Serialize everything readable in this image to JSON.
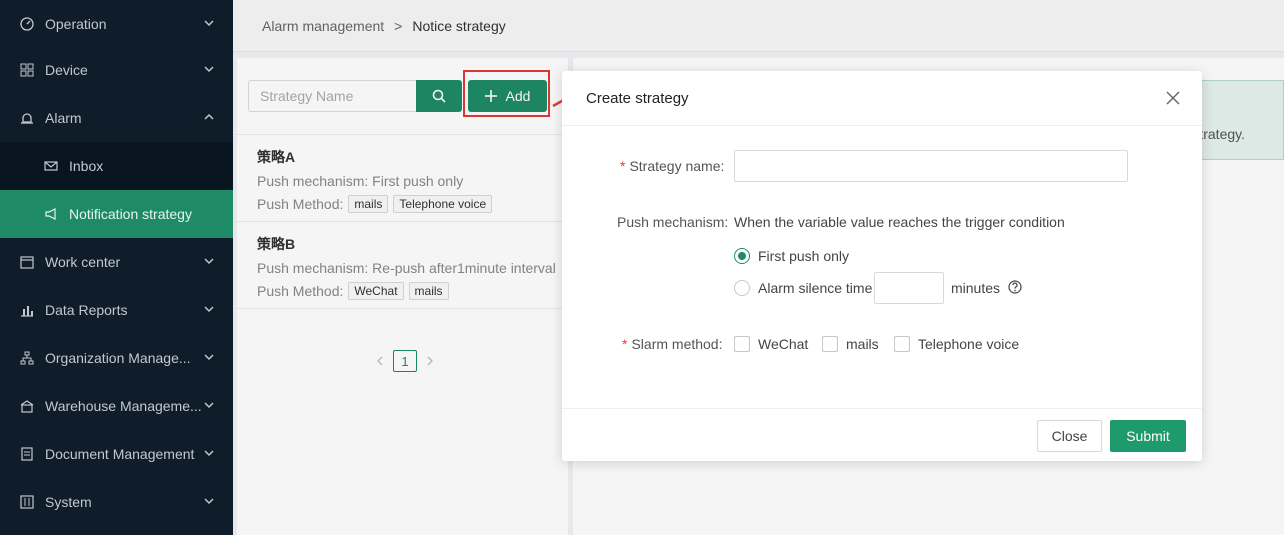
{
  "sidebar": {
    "items": [
      {
        "label": "Operation",
        "icon": "dashboard-icon"
      },
      {
        "label": "Device",
        "icon": "grid-icon"
      },
      {
        "label": "Alarm",
        "icon": "alarm-icon"
      },
      {
        "label": "Inbox",
        "icon": "mail-icon"
      },
      {
        "label": "Notification strategy",
        "icon": "megaphone-icon"
      },
      {
        "label": "Work center",
        "icon": "calendar-icon"
      },
      {
        "label": "Data Reports",
        "icon": "bar-chart-icon"
      },
      {
        "label": "Organization Manage...",
        "icon": "org-icon"
      },
      {
        "label": "Warehouse Manageme...",
        "icon": "warehouse-icon"
      },
      {
        "label": "Document Management",
        "icon": "document-icon"
      },
      {
        "label": "System",
        "icon": "settings-icon"
      }
    ],
    "active_color": "#1f8b66"
  },
  "breadcrumb": {
    "parent": "Alarm management",
    "separator": ">",
    "current": "Notice strategy"
  },
  "toolbar": {
    "search_placeholder": "Strategy Name",
    "add_label": "Add"
  },
  "strategies": [
    {
      "name": "策略A",
      "mechanism_label": "Push mechanism:",
      "mechanism_value": "First push only",
      "method_label": "Push Method:",
      "methods": [
        "mails",
        "Telephone voice"
      ]
    },
    {
      "name": "策略B",
      "mechanism_label": "Push mechanism:",
      "mechanism_value": "Re-push after1minute interval",
      "method_label": "Push Method:",
      "methods": [
        "WeChat",
        "mails"
      ]
    }
  ],
  "pagination": {
    "current": "1"
  },
  "banner_text": "trategy.",
  "dialog": {
    "title": "Create strategy",
    "strategy_name_label": "Strategy name:",
    "strategy_name_value": "",
    "push_mechanism_label": "Push mechanism:",
    "push_mechanism_desc": "When the variable value reaches the trigger condition",
    "option_first_push": "First push only",
    "option_silence": "Alarm silence time",
    "silence_unit": "minutes",
    "alarm_method_label": "Slarm method:",
    "methods": [
      "WeChat",
      "mails",
      "Telephone voice"
    ],
    "close_label": "Close",
    "submit_label": "Submit"
  }
}
